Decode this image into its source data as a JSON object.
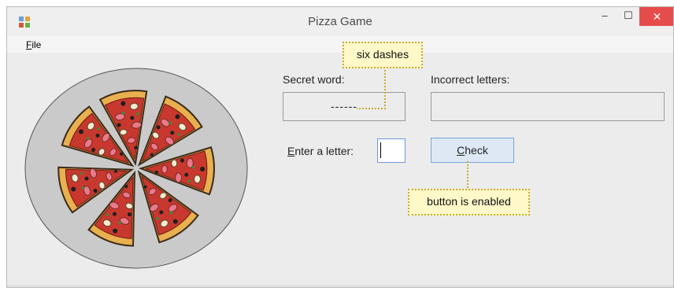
{
  "window": {
    "title": "Pizza Game",
    "controls": {
      "minimize_icon": "minimize-icon",
      "maximize_icon": "maximize-icon",
      "close_icon": "close-icon",
      "close_color": "#e74c4c"
    }
  },
  "menu": {
    "items": [
      {
        "label": "File",
        "mnemonic": "F"
      }
    ]
  },
  "form": {
    "secret_word_label": "Secret word:",
    "secret_word_value": "------",
    "incorrect_letters_label": "Incorrect letters:",
    "incorrect_letters_value": "",
    "enter_letter_label": "Enter a letter:",
    "enter_letter_mnemonic": "E",
    "letter_input_value": "",
    "check_button_label": "Check",
    "check_button_mnemonic": "C",
    "check_button_enabled": true
  },
  "callouts": {
    "dashes": "six dashes",
    "button_enabled": "button is enabled",
    "color": "#fff8c8",
    "border_color": "#c8aa32"
  },
  "image": {
    "name": "pizza-image",
    "slices": 7
  }
}
